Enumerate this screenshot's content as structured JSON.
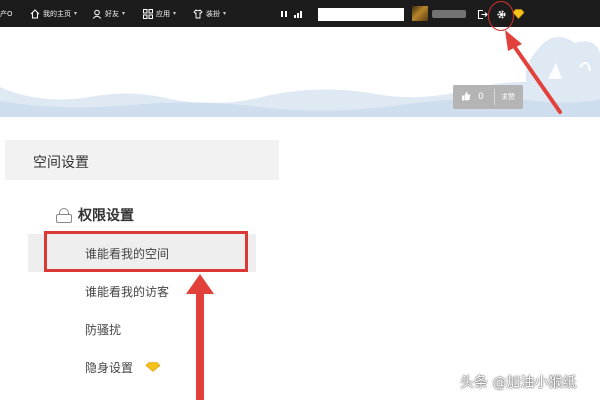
{
  "topbar": {
    "edge_label": "产O",
    "home": "我的主页",
    "friends": "好友",
    "apps": "应用",
    "dressup": "装扮",
    "search_value": "",
    "signal_icon": "signal-bars-icon",
    "pause_icon": "pause-icon",
    "logout_icon": "exit-icon",
    "settings_icon": "gear-icon",
    "vip_icon": "diamond-icon"
  },
  "banner": {
    "like_count": "0",
    "like_label": "求赞"
  },
  "space_settings": {
    "title": "空间设置"
  },
  "permissions": {
    "title": "权限设置",
    "items": [
      {
        "label": "谁能看我的空间",
        "active": true
      },
      {
        "label": "谁能看我的访客",
        "active": false
      },
      {
        "label": "防骚扰",
        "active": false
      },
      {
        "label": "隐身设置",
        "active": false,
        "vip": true
      }
    ]
  },
  "watermark": "头条 @加油小猴纸",
  "colors": {
    "topbar_bg": "#1c1c1c",
    "highlight_red": "#d93a35",
    "sky_blue": "#dfe9f4",
    "vip_gold": "#f5c21b"
  }
}
